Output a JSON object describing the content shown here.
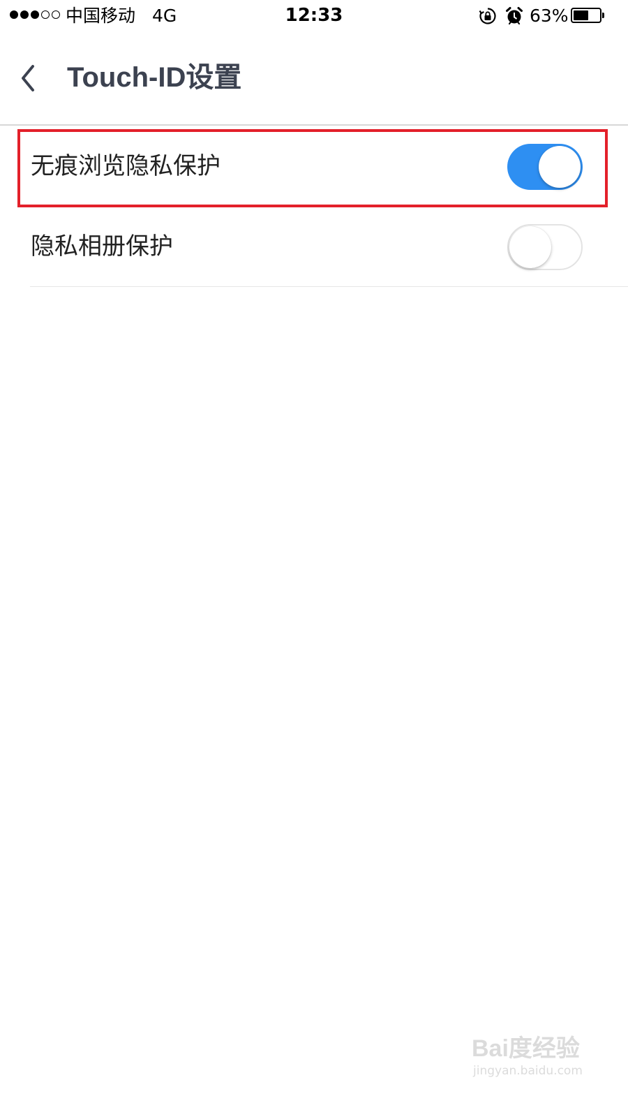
{
  "status_bar": {
    "signal_bars_filled": 3,
    "signal_bars_total": 5,
    "carrier": "中国移动",
    "network": "4G",
    "time": "12:33",
    "battery_percent_text": "63%",
    "battery_level": 0.63,
    "icons": [
      "signal-dots-icon",
      "rotation-lock-icon",
      "alarm-icon",
      "battery-icon"
    ]
  },
  "nav": {
    "back_icon": "chevron-left-icon",
    "title": "Touch-ID设置"
  },
  "settings": [
    {
      "label": "无痕浏览隐私保护",
      "enabled": true
    },
    {
      "label": "隐私相册保护",
      "enabled": false
    }
  ],
  "colors": {
    "toggle_on": "#2e8ff2",
    "highlight_border": "#e3202a",
    "title_text": "#3c4250"
  },
  "watermark": {
    "logo": "Bai度经验",
    "url": "jingyan.baidu.com"
  }
}
